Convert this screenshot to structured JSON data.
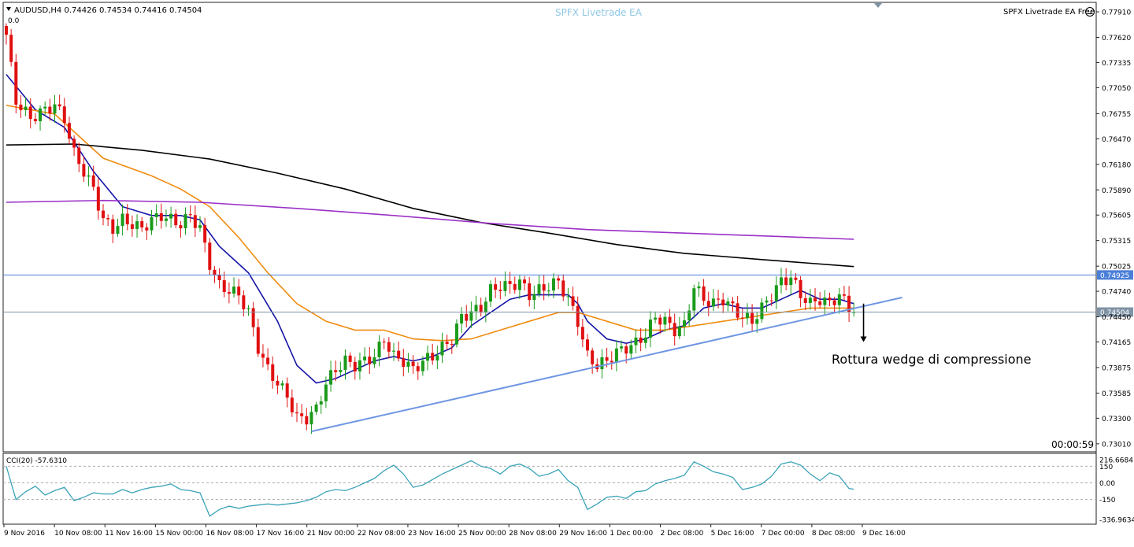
{
  "header": {
    "symbol_line": "AUDUSD,H4  0.74426 0.74534 0.74416 0.74504",
    "sub_value": "0.0",
    "ea_title": "SPFX Livetrade EA",
    "ea_badge": "SPFX Livetrade EA Free"
  },
  "annotation": "Rottura wedge di compressione",
  "countdown": "00:00:59",
  "indicator": {
    "label": "CCI(20) -57.6310"
  },
  "colors": {
    "bull": "#1a9b1a",
    "bear": "#e01010",
    "ma_fast": "#1414a8",
    "ma_mid": "#f08c10",
    "ma_slow": "#000000",
    "ma_long": "#9b30c8",
    "hline": "#4a7fd8",
    "trendline": "#6f96e4",
    "cci": "#3aa3b8",
    "bid_line": "#7f93a6"
  },
  "chart_data": {
    "type": "candlestick",
    "title": "AUDUSD,H4",
    "ylim": [
      0.72955,
      0.77955
    ],
    "y_ticks": [
      "0.77910",
      "0.77620",
      "0.77335",
      "0.77050",
      "0.76755",
      "0.76470",
      "0.76180",
      "0.75890",
      "0.75605",
      "0.75315",
      "0.75025",
      "0.74740",
      "0.74450",
      "0.74165",
      "0.73875",
      "0.73585",
      "0.73300",
      "0.73010"
    ],
    "x_ticks": [
      "9 Nov 2016",
      "10 Nov 08:00",
      "11 Nov 16:00",
      "15 Nov 00:00",
      "16 Nov 08:00",
      "17 Nov 16:00",
      "21 Nov 00:00",
      "22 Nov 08:00",
      "23 Nov 16:00",
      "25 Nov 00:00",
      "28 Nov 08:00",
      "29 Nov 16:00",
      "1 Dec 00:00",
      "2 Dec 08:00",
      "5 Dec 16:00",
      "7 Dec 00:00",
      "8 Dec 08:00",
      "9 Dec 16:00"
    ],
    "close_anchors": [
      [
        0,
        0.7765
      ],
      [
        2,
        0.769
      ],
      [
        5,
        0.767
      ],
      [
        8,
        0.768
      ],
      [
        10,
        0.7685
      ],
      [
        12,
        0.767
      ],
      [
        14,
        0.763
      ],
      [
        16,
        0.761
      ],
      [
        18,
        0.759
      ],
      [
        20,
        0.7555
      ],
      [
        22,
        0.7545
      ],
      [
        24,
        0.7555
      ],
      [
        26,
        0.755
      ],
      [
        28,
        0.7545
      ],
      [
        30,
        0.7555
      ],
      [
        32,
        0.756
      ],
      [
        34,
        0.7555
      ],
      [
        36,
        0.755
      ],
      [
        38,
        0.756
      ],
      [
        40,
        0.7545
      ],
      [
        42,
        0.7505
      ],
      [
        44,
        0.748
      ],
      [
        46,
        0.7475
      ],
      [
        48,
        0.747
      ],
      [
        50,
        0.745
      ],
      [
        52,
        0.741
      ],
      [
        54,
        0.7385
      ],
      [
        56,
        0.737
      ],
      [
        58,
        0.7355
      ],
      [
        60,
        0.733
      ],
      [
        62,
        0.733
      ],
      [
        64,
        0.734
      ],
      [
        66,
        0.737
      ],
      [
        68,
        0.7385
      ],
      [
        70,
        0.7395
      ],
      [
        72,
        0.739
      ],
      [
        74,
        0.7395
      ],
      [
        76,
        0.74
      ],
      [
        78,
        0.742
      ],
      [
        80,
        0.74
      ],
      [
        82,
        0.7395
      ],
      [
        84,
        0.7385
      ],
      [
        86,
        0.7395
      ],
      [
        88,
        0.74
      ],
      [
        90,
        0.741
      ],
      [
        92,
        0.742
      ],
      [
        94,
        0.7445
      ],
      [
        96,
        0.745
      ],
      [
        98,
        0.7455
      ],
      [
        100,
        0.7475
      ],
      [
        102,
        0.748
      ],
      [
        104,
        0.748
      ],
      [
        106,
        0.7485
      ],
      [
        108,
        0.747
      ],
      [
        110,
        0.7475
      ],
      [
        112,
        0.748
      ],
      [
        114,
        0.7485
      ],
      [
        116,
        0.7465
      ],
      [
        118,
        0.744
      ],
      [
        120,
        0.74
      ],
      [
        122,
        0.739
      ],
      [
        124,
        0.7395
      ],
      [
        126,
        0.7405
      ],
      [
        128,
        0.741
      ],
      [
        130,
        0.7415
      ],
      [
        132,
        0.7425
      ],
      [
        134,
        0.7445
      ],
      [
        136,
        0.744
      ],
      [
        138,
        0.743
      ],
      [
        140,
        0.7435
      ],
      [
        142,
        0.748
      ],
      [
        144,
        0.7465
      ],
      [
        146,
        0.746
      ],
      [
        148,
        0.7465
      ],
      [
        150,
        0.7455
      ],
      [
        152,
        0.7445
      ],
      [
        154,
        0.744
      ],
      [
        156,
        0.7455
      ],
      [
        158,
        0.747
      ],
      [
        160,
        0.7485
      ],
      [
        162,
        0.749
      ],
      [
        164,
        0.747
      ],
      [
        166,
        0.746
      ],
      [
        168,
        0.7465
      ],
      [
        170,
        0.746
      ],
      [
        172,
        0.747
      ],
      [
        174,
        0.7455
      ],
      [
        175,
        0.74504
      ]
    ],
    "moving_averages": [
      {
        "period": "fast",
        "color": "#1414a8",
        "points": [
          [
            0,
            0.772
          ],
          [
            6,
            0.768
          ],
          [
            12,
            0.766
          ],
          [
            18,
            0.761
          ],
          [
            24,
            0.757
          ],
          [
            30,
            0.756
          ],
          [
            36,
            0.756
          ],
          [
            40,
            0.7555
          ],
          [
            44,
            0.7525
          ],
          [
            50,
            0.7495
          ],
          [
            56,
            0.744
          ],
          [
            60,
            0.739
          ],
          [
            64,
            0.737
          ],
          [
            68,
            0.7375
          ],
          [
            72,
            0.7385
          ],
          [
            76,
            0.7395
          ],
          [
            80,
            0.74
          ],
          [
            84,
            0.7395
          ],
          [
            88,
            0.74
          ],
          [
            92,
            0.741
          ],
          [
            96,
            0.7435
          ],
          [
            100,
            0.745
          ],
          [
            104,
            0.7465
          ],
          [
            108,
            0.747
          ],
          [
            112,
            0.747
          ],
          [
            116,
            0.747
          ],
          [
            118,
            0.746
          ],
          [
            120,
            0.744
          ],
          [
            124,
            0.742
          ],
          [
            128,
            0.7415
          ],
          [
            132,
            0.742
          ],
          [
            136,
            0.743
          ],
          [
            140,
            0.7435
          ],
          [
            144,
            0.7455
          ],
          [
            148,
            0.746
          ],
          [
            152,
            0.7455
          ],
          [
            156,
            0.7455
          ],
          [
            160,
            0.7465
          ],
          [
            164,
            0.7475
          ],
          [
            168,
            0.7465
          ],
          [
            172,
            0.7465
          ],
          [
            175,
            0.746
          ]
        ]
      },
      {
        "period": "mid",
        "color": "#f08c10",
        "points": [
          [
            0,
            0.7685
          ],
          [
            10,
            0.7675
          ],
          [
            20,
            0.7625
          ],
          [
            30,
            0.7605
          ],
          [
            36,
            0.759
          ],
          [
            42,
            0.757
          ],
          [
            48,
            0.7535
          ],
          [
            54,
            0.7495
          ],
          [
            60,
            0.746
          ],
          [
            66,
            0.744
          ],
          [
            72,
            0.743
          ],
          [
            78,
            0.743
          ],
          [
            84,
            0.742
          ],
          [
            90,
            0.7418
          ],
          [
            96,
            0.742
          ],
          [
            102,
            0.743
          ],
          [
            108,
            0.744
          ],
          [
            114,
            0.745
          ],
          [
            118,
            0.745
          ],
          [
            124,
            0.744
          ],
          [
            130,
            0.743
          ],
          [
            136,
            0.743
          ],
          [
            142,
            0.7435
          ],
          [
            148,
            0.744
          ],
          [
            154,
            0.7445
          ],
          [
            160,
            0.745
          ],
          [
            166,
            0.7455
          ],
          [
            172,
            0.7455
          ],
          [
            175,
            0.7455
          ]
        ]
      },
      {
        "period": "slow",
        "color": "#000000",
        "points": [
          [
            0,
            0.764
          ],
          [
            14,
            0.7641
          ],
          [
            28,
            0.7634
          ],
          [
            42,
            0.7624
          ],
          [
            56,
            0.7608
          ],
          [
            70,
            0.759
          ],
          [
            84,
            0.7568
          ],
          [
            98,
            0.7552
          ],
          [
            112,
            0.754
          ],
          [
            126,
            0.7527
          ],
          [
            140,
            0.7517
          ],
          [
            156,
            0.751
          ],
          [
            175,
            0.7502
          ]
        ]
      },
      {
        "period": "long",
        "color": "#9b30c8",
        "points": [
          [
            0,
            0.7575
          ],
          [
            20,
            0.7577
          ],
          [
            40,
            0.7575
          ],
          [
            60,
            0.7568
          ],
          [
            80,
            0.756
          ],
          [
            100,
            0.7551
          ],
          [
            120,
            0.7544
          ],
          [
            140,
            0.754
          ],
          [
            160,
            0.7536
          ],
          [
            175,
            0.7533
          ]
        ]
      }
    ],
    "h_levels": [
      {
        "value": 0.74925,
        "label": "0.74925",
        "color": "#4a7fd8"
      },
      {
        "value": 0.74504,
        "label": "0.74504",
        "color": "#7f93a6"
      }
    ],
    "trendline": {
      "from": [
        63,
        0.7315
      ],
      "to": [
        185,
        0.7467
      ],
      "color": "#6f96e4"
    },
    "arrow": {
      "bar": 177,
      "from": 0.746,
      "to": 0.74165
    },
    "cci": {
      "ylim": [
        -336.9634,
        216.6684
      ],
      "ticks": [
        "216.6684",
        "150",
        "0.00",
        "-150",
        "-336.9634"
      ],
      "levels": [
        150,
        0,
        -150
      ],
      "points": [
        [
          0,
          150
        ],
        [
          2,
          -150
        ],
        [
          4,
          -80
        ],
        [
          6,
          -30
        ],
        [
          8,
          -110
        ],
        [
          10,
          -70
        ],
        [
          12,
          -40
        ],
        [
          14,
          -160
        ],
        [
          16,
          -130
        ],
        [
          18,
          -90
        ],
        [
          20,
          -100
        ],
        [
          22,
          -100
        ],
        [
          24,
          -60
        ],
        [
          26,
          -90
        ],
        [
          28,
          -60
        ],
        [
          30,
          -40
        ],
        [
          32,
          -30
        ],
        [
          34,
          -10
        ],
        [
          36,
          -60
        ],
        [
          38,
          -70
        ],
        [
          40,
          -90
        ],
        [
          42,
          -300
        ],
        [
          44,
          -240
        ],
        [
          46,
          -210
        ],
        [
          48,
          -230
        ],
        [
          50,
          -210
        ],
        [
          52,
          -200
        ],
        [
          54,
          -190
        ],
        [
          56,
          -200
        ],
        [
          58,
          -190
        ],
        [
          60,
          -180
        ],
        [
          62,
          -160
        ],
        [
          64,
          -130
        ],
        [
          66,
          -80
        ],
        [
          68,
          -60
        ],
        [
          70,
          -70
        ],
        [
          72,
          -40
        ],
        [
          74,
          0
        ],
        [
          76,
          40
        ],
        [
          78,
          110
        ],
        [
          80,
          160
        ],
        [
          82,
          80
        ],
        [
          84,
          -40
        ],
        [
          86,
          -20
        ],
        [
          88,
          30
        ],
        [
          90,
          80
        ],
        [
          92,
          120
        ],
        [
          94,
          160
        ],
        [
          96,
          200
        ],
        [
          98,
          150
        ],
        [
          100,
          130
        ],
        [
          102,
          80
        ],
        [
          104,
          150
        ],
        [
          106,
          170
        ],
        [
          108,
          130
        ],
        [
          110,
          60
        ],
        [
          112,
          80
        ],
        [
          114,
          120
        ],
        [
          116,
          20
        ],
        [
          118,
          -40
        ],
        [
          120,
          -240
        ],
        [
          122,
          -190
        ],
        [
          124,
          -130
        ],
        [
          126,
          -120
        ],
        [
          128,
          -140
        ],
        [
          130,
          -80
        ],
        [
          132,
          -70
        ],
        [
          134,
          -10
        ],
        [
          136,
          20
        ],
        [
          138,
          40
        ],
        [
          140,
          70
        ],
        [
          142,
          190
        ],
        [
          144,
          150
        ],
        [
          146,
          100
        ],
        [
          148,
          80
        ],
        [
          150,
          50
        ],
        [
          152,
          -60
        ],
        [
          154,
          -40
        ],
        [
          156,
          -10
        ],
        [
          158,
          60
        ],
        [
          160,
          170
        ],
        [
          162,
          190
        ],
        [
          164,
          160
        ],
        [
          166,
          80
        ],
        [
          168,
          20
        ],
        [
          170,
          90
        ],
        [
          172,
          60
        ],
        [
          174,
          -50
        ],
        [
          175,
          -57.6
        ]
      ]
    }
  }
}
